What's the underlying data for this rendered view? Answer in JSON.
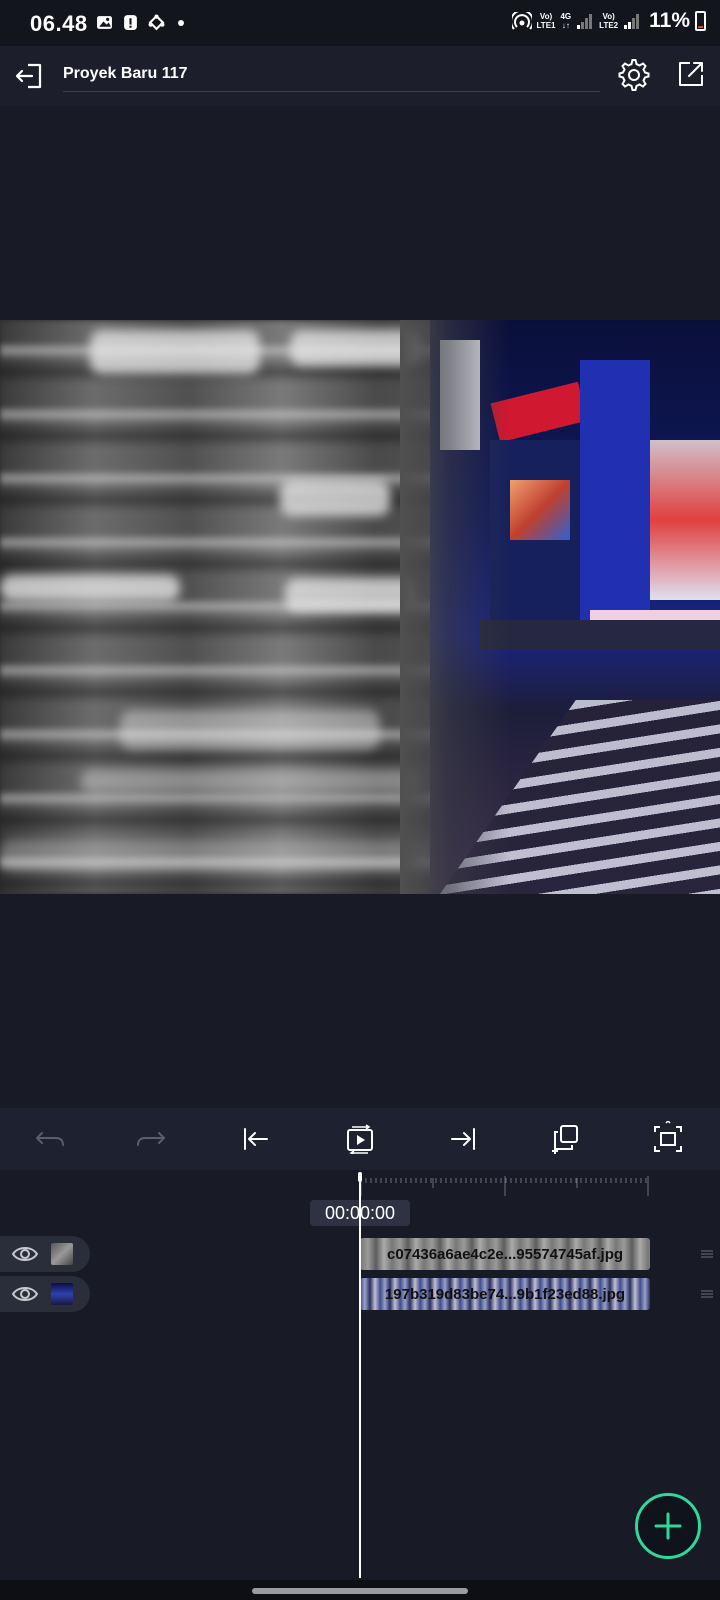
{
  "status_bar": {
    "time": "06.48",
    "left_icons": [
      "image-icon",
      "alert-icon",
      "sync-icon"
    ],
    "net1_top": "Vo)",
    "net1_bottom": "LTE1",
    "net_type": "4G",
    "net2_top": "Vo)",
    "net2_bottom": "LTE2",
    "battery": "11%"
  },
  "header": {
    "project_title": "Proyek Baru 117"
  },
  "timeline": {
    "current_time": "00:00:00",
    "tracks": [
      {
        "clip_name": "c07436a6ae4c2e...95574745af.jpg"
      },
      {
        "clip_name": "197b319d83be74...9b1f23ed88.jpg"
      }
    ]
  },
  "colors": {
    "accent": "#2ed89a",
    "background": "#181b26",
    "toolbar": "#1e2130"
  }
}
